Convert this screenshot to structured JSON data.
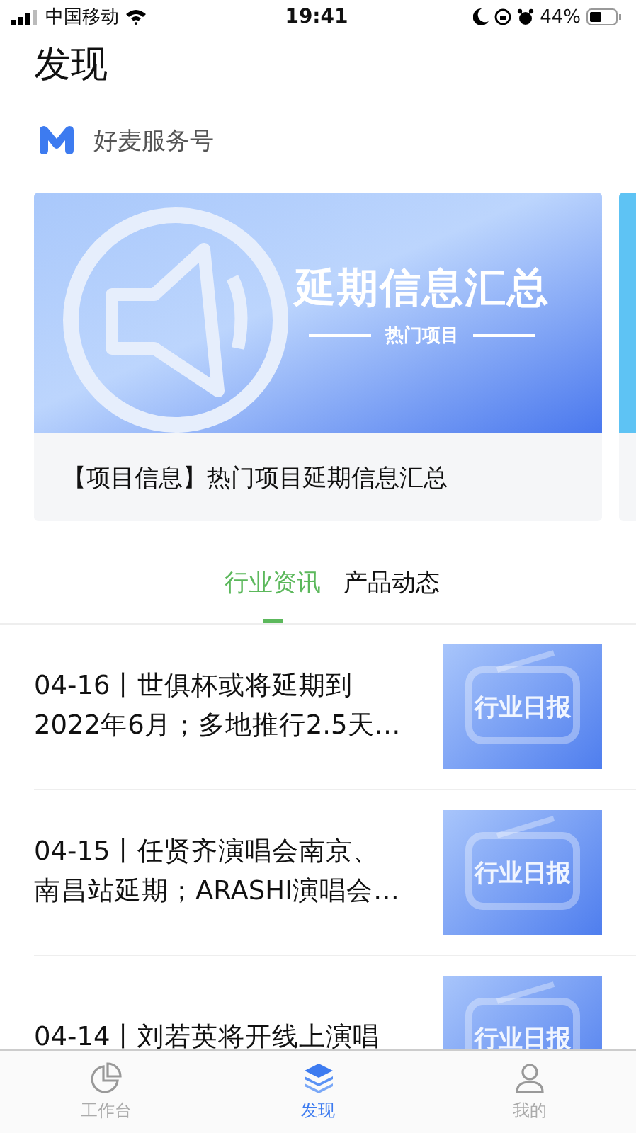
{
  "status_bar": {
    "carrier": "中国移动",
    "time": "19:41",
    "battery": "44%"
  },
  "title": "发现",
  "service": {
    "name": "好麦服务号"
  },
  "banners": [
    {
      "headline": "延期信息汇总",
      "tagline": "热门项目",
      "caption": "【项目信息】热门项目延期信息汇总"
    }
  ],
  "tabs": [
    {
      "label": "行业资讯",
      "selected": true
    },
    {
      "label": "产品动态",
      "selected": false
    }
  ],
  "articles": [
    {
      "lines": [
        "04-16丨世俱杯或将延期到",
        "2022年6月；多地推行2.5天…"
      ],
      "thumbnail": "行业日报"
    },
    {
      "lines": [
        "04-15丨任贤齐演唱会南京、",
        "南昌站延期；ARASHI演唱会…"
      ],
      "thumbnail": "行业日报"
    },
    {
      "lines": [
        "04-14丨刘若英将开线上演唱"
      ],
      "thumbnail": "行业日报"
    }
  ],
  "nav": [
    {
      "kind": "workbench",
      "label": "工作台",
      "selected": false
    },
    {
      "kind": "discover",
      "label": "发现",
      "selected": true
    },
    {
      "kind": "profile",
      "label": "我的",
      "selected": false
    }
  ]
}
